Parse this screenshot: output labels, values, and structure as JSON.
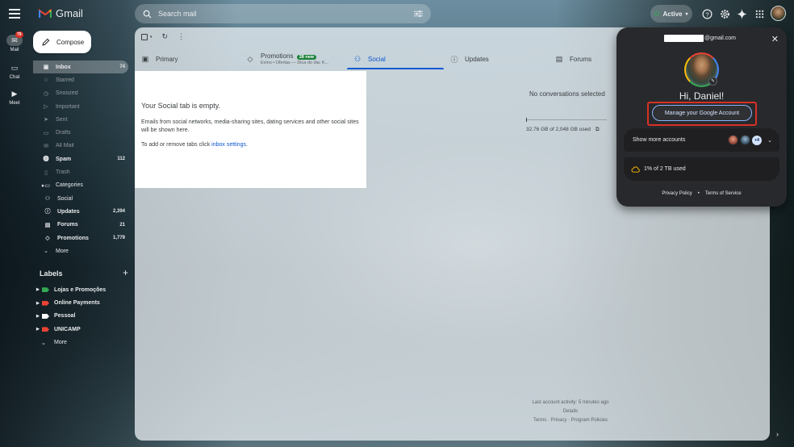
{
  "app": {
    "name": "Gmail"
  },
  "rail": {
    "items": [
      {
        "label": "Mail",
        "badge": "79"
      },
      {
        "label": "Chat"
      },
      {
        "label": "Meet"
      }
    ]
  },
  "search": {
    "placeholder": "Search mail"
  },
  "header": {
    "status_label": "Active"
  },
  "compose": {
    "label": "Compose"
  },
  "nav": {
    "items": [
      {
        "label": "Inbox",
        "count": "74",
        "icon": "inbox-icon"
      },
      {
        "label": "Starred",
        "icon": "star-icon"
      },
      {
        "label": "Snoozed",
        "icon": "clock-icon"
      },
      {
        "label": "Important",
        "icon": "label-important-icon"
      },
      {
        "label": "Sent",
        "icon": "send-icon"
      },
      {
        "label": "Drafts",
        "icon": "draft-icon"
      },
      {
        "label": "All Mail",
        "icon": "mail-icon"
      },
      {
        "label": "Spam",
        "count": "112",
        "icon": "spam-icon"
      },
      {
        "label": "Trash",
        "icon": "trash-icon"
      },
      {
        "label": "Categories",
        "icon": "category-icon"
      },
      {
        "label": "Social",
        "icon": "people-icon"
      },
      {
        "label": "Updates",
        "count": "2,394",
        "icon": "info-icon"
      },
      {
        "label": "Forums",
        "count": "21",
        "icon": "forum-icon"
      },
      {
        "label": "Promotions",
        "count": "1,779",
        "icon": "tag-icon"
      },
      {
        "label": "More",
        "icon": "chevron-down-icon"
      }
    ]
  },
  "labels": {
    "title": "Labels",
    "items": [
      {
        "label": "Lojas e Promoções",
        "color": "#34a853"
      },
      {
        "label": "Online Payments",
        "color": "#ea4335"
      },
      {
        "label": "Pessoal",
        "color": "#ffffff"
      },
      {
        "label": "UNICAMP",
        "color": "#ea4335"
      }
    ],
    "more": "More"
  },
  "tabs": {
    "primary": "Primary",
    "promotions": "Promotions",
    "promotions_badge": "28 new",
    "promotions_preview": "Evino • Ofertas — Dica do dia: K...",
    "social": "Social",
    "updates": "Updates",
    "forums": "Forums"
  },
  "social_empty": {
    "title": "Your Social tab is empty.",
    "body": "Emails from social networks, media-sharing sites, dating services and other social sites will be shown here.",
    "hint_prefix": "To add or remove tabs click ",
    "hint_link": "inbox settings",
    "hint_suffix": "."
  },
  "reading_pane": {
    "no_conversations": "No conversations selected",
    "storage": "32.76 GB of 2,048 GB used",
    "last_activity": "Last account activity: 5 minutes ago",
    "details": "Details",
    "terms": "Terms",
    "privacy": "Privacy",
    "program_policies": "Program Policies"
  },
  "account_popup": {
    "email_suffix": "@gmail.com",
    "greeting": "Hi, Daniel!",
    "manage_label": "Manage your Google Account",
    "show_more": "Show more accounts",
    "extra_accounts": "+4",
    "storage_label": "1% of 2 TB used",
    "privacy": "Privacy Policy",
    "terms": "Terms of Service"
  }
}
